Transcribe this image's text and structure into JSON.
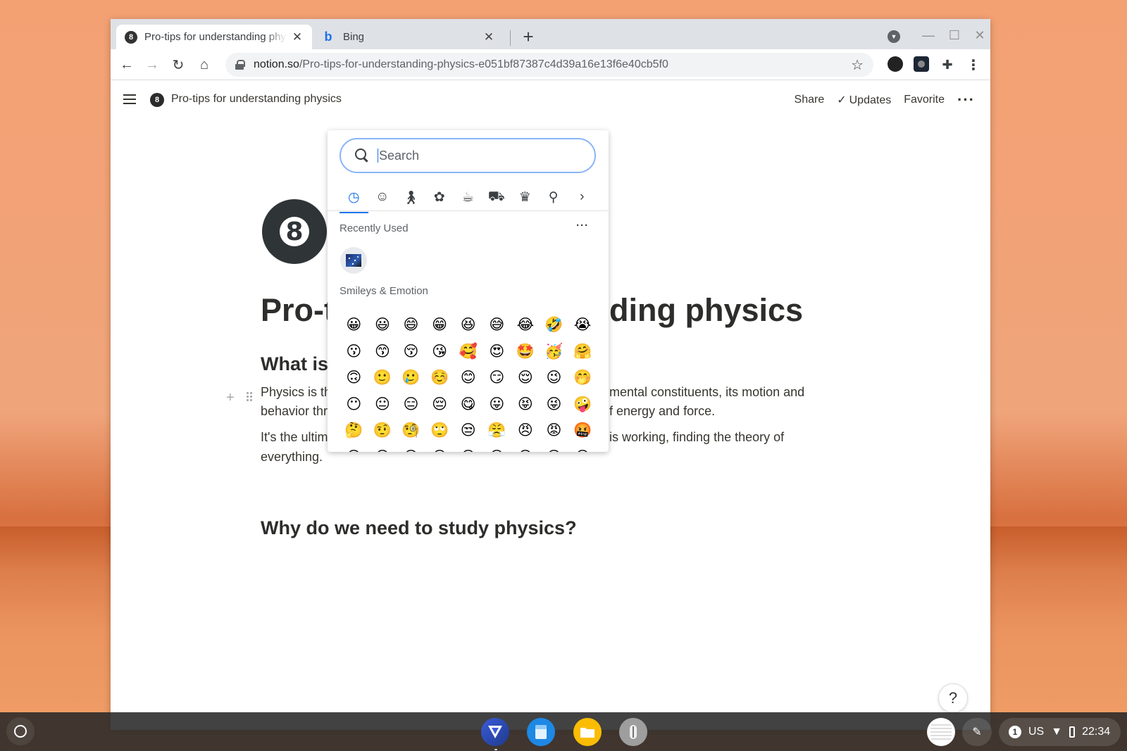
{
  "browser": {
    "tabs": [
      {
        "title": "Pro-tips for understanding physics",
        "favicon": "8"
      },
      {
        "title": "Bing",
        "favicon": "b"
      }
    ],
    "new_tab_label": "+",
    "url_host": "notion.so",
    "url_path": "/Pro-tips-for-understanding-physics-e051bf87387c4d39a16e13f6e40cb5f0"
  },
  "notion": {
    "breadcrumb": "Pro-tips for understanding physics",
    "share_label": "Share",
    "updates_label": "Updates",
    "favorite_label": "Favorite",
    "page_icon_glyph": "8",
    "title_left": "Pro-t",
    "title_right": "ding physics",
    "heading1_left": "What is",
    "para1_line1_left": "Physics is th",
    "para1_line1_right": "mental constituents, its motion and",
    "para1_line2_left": "behavior thr",
    "para1_line2_right": "f energy and force.",
    "para2_line1_left": "It's the ultim",
    "para2_line1_right": "is working, finding the theory of",
    "para2_line2": "everything.",
    "heading2": "Why do we need to study physics?",
    "help_label": "?"
  },
  "emoji_picker": {
    "search_placeholder": "Search",
    "categories": [
      "clock-icon",
      "smiley-icon",
      "person-icon",
      "animal-icon",
      "food-icon",
      "travel-icon",
      "trophy-icon",
      "lightbulb-icon",
      "chevron-right-icon"
    ],
    "recently_used_label": "Recently Used",
    "smileys_label": "Smileys & Emotion",
    "emojis": [
      "😀",
      "😃",
      "😄",
      "😁",
      "😆",
      "😅",
      "😂",
      "🤣",
      "😭",
      "😗",
      "😙",
      "😚",
      "😘",
      "🥰",
      "😍",
      "🤩",
      "🥳",
      "🤗",
      "🙃",
      "🙂",
      "🥲",
      "☺️",
      "😊",
      "😏",
      "😌",
      "😉",
      "🤭",
      "😶",
      "😐",
      "😑",
      "😔",
      "😋",
      "😛",
      "😝",
      "😜",
      "🤪",
      "🤔",
      "🤨",
      "🧐",
      "🙄",
      "😒",
      "😤",
      "😠",
      "😡",
      "🤬",
      "😞",
      "😟",
      "😕",
      "😣",
      "😖",
      "😫",
      "😩",
      "😢",
      "😥"
    ]
  },
  "shelf": {
    "keyboard_layout": "US",
    "notification_count": "1",
    "time": "22:34"
  }
}
